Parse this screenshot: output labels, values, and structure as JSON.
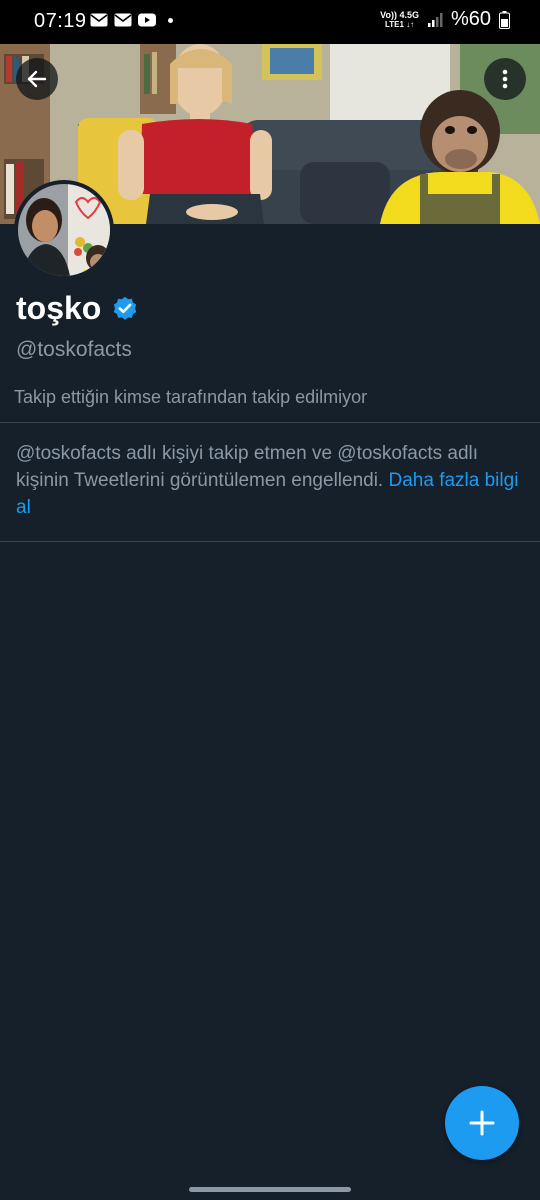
{
  "status_bar": {
    "time": "07:19",
    "notification_icons": [
      "mail-icon",
      "mail-icon",
      "youtube-icon",
      "dot-icon"
    ],
    "network_top": "Vo)) 4.5G",
    "network_bottom": "LTE1 ↓↑",
    "battery": "%60"
  },
  "header": {
    "back_icon": "arrow-left-icon",
    "more_icon": "more-vertical-icon"
  },
  "profile": {
    "display_name": "toşko",
    "verified_icon": "verified-badge-icon",
    "handle": "@toskofacts",
    "follow_note": "Takip ettiğin kimse tarafından takip edilmiyor",
    "blocked_message": "@toskofacts adlı kişiyi takip etmen ve @toskofacts adlı kişinin Tweetlerini görüntülemen engellendi.",
    "learn_more": "Daha fazla bilgi al"
  },
  "fab": {
    "icon": "plus-icon"
  },
  "colors": {
    "background": "#15202b",
    "text": "#ffffff",
    "secondary_text": "#8b98a5",
    "accent": "#1d9bf0",
    "divider": "#38444d"
  }
}
